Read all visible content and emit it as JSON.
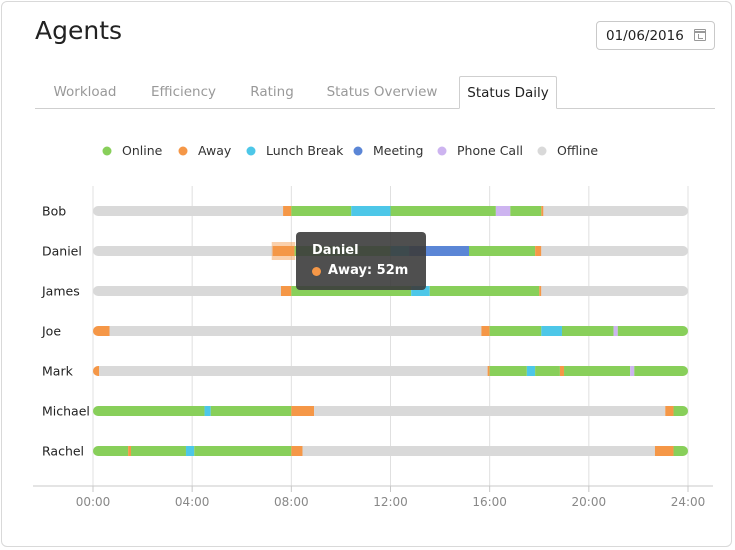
{
  "header": {
    "title": "Agents",
    "date": "01/06/2016"
  },
  "tabs": [
    {
      "label": "Workload"
    },
    {
      "label": "Efficiency"
    },
    {
      "label": "Rating"
    },
    {
      "label": "Status Overview"
    },
    {
      "label": "Status Daily"
    }
  ],
  "active_tab": "Status Daily",
  "tooltip": {
    "title": "Daniel",
    "status": "Away",
    "value": "52m",
    "text": "Away: 52m",
    "color": "#f59747"
  },
  "chart_data": {
    "type": "timeline",
    "title": "",
    "xlabel": "",
    "ylabel": "",
    "x_range": [
      "00:00",
      "24:00"
    ],
    "x_ticks": [
      "00:00",
      "04:00",
      "08:00",
      "12:00",
      "16:00",
      "20:00",
      "24:00"
    ],
    "legend_position": "top",
    "legend": [
      {
        "name": "Online",
        "color": "#88cf5a"
      },
      {
        "name": "Away",
        "color": "#f59747"
      },
      {
        "name": "Lunch Break",
        "color": "#4dc7e8"
      },
      {
        "name": "Meeting",
        "color": "#5b86d6"
      },
      {
        "name": "Phone Call",
        "color": "#cdb4f0"
      },
      {
        "name": "Offline",
        "color": "#d9d9d9"
      }
    ],
    "agents": [
      {
        "name": "Bob",
        "segments": [
          {
            "status": "Offline",
            "start": "00:00",
            "end": "07:40"
          },
          {
            "status": "Away",
            "start": "07:40",
            "end": "08:00"
          },
          {
            "status": "Online",
            "start": "08:00",
            "end": "10:25"
          },
          {
            "status": "Lunch Break",
            "start": "10:25",
            "end": "12:00"
          },
          {
            "status": "Online",
            "start": "12:00",
            "end": "16:15"
          },
          {
            "status": "Phone Call",
            "start": "16:15",
            "end": "16:50"
          },
          {
            "status": "Online",
            "start": "16:50",
            "end": "18:05"
          },
          {
            "status": "Away",
            "start": "18:05",
            "end": "18:10"
          },
          {
            "status": "Offline",
            "start": "18:10",
            "end": "24:00"
          }
        ]
      },
      {
        "name": "Daniel",
        "segments": [
          {
            "status": "Offline",
            "start": "00:00",
            "end": "07:15"
          },
          {
            "status": "Away",
            "start": "07:15",
            "end": "08:07"
          },
          {
            "status": "Online",
            "start": "08:07",
            "end": "12:00"
          },
          {
            "status": "Lunch Break",
            "start": "12:00",
            "end": "12:45"
          },
          {
            "status": "Meeting",
            "start": "12:45",
            "end": "15:10"
          },
          {
            "status": "Online",
            "start": "15:10",
            "end": "17:50"
          },
          {
            "status": "Away",
            "start": "17:50",
            "end": "18:05"
          },
          {
            "status": "Offline",
            "start": "18:05",
            "end": "24:00"
          }
        ]
      },
      {
        "name": "James",
        "segments": [
          {
            "status": "Offline",
            "start": "00:00",
            "end": "07:35"
          },
          {
            "status": "Away",
            "start": "07:35",
            "end": "08:00"
          },
          {
            "status": "Online",
            "start": "08:00",
            "end": "12:50"
          },
          {
            "status": "Lunch Break",
            "start": "12:50",
            "end": "13:35"
          },
          {
            "status": "Online",
            "start": "13:35",
            "end": "18:00"
          },
          {
            "status": "Away",
            "start": "18:00",
            "end": "18:05"
          },
          {
            "status": "Offline",
            "start": "18:05",
            "end": "24:00"
          }
        ]
      },
      {
        "name": "Joe",
        "segments": [
          {
            "status": "Away",
            "start": "00:00",
            "end": "00:40"
          },
          {
            "status": "Offline",
            "start": "00:40",
            "end": "15:40"
          },
          {
            "status": "Away",
            "start": "15:40",
            "end": "16:00"
          },
          {
            "status": "Online",
            "start": "16:00",
            "end": "18:05"
          },
          {
            "status": "Lunch Break",
            "start": "18:05",
            "end": "18:55"
          },
          {
            "status": "Online",
            "start": "18:55",
            "end": "21:00"
          },
          {
            "status": "Phone Call",
            "start": "21:00",
            "end": "21:10"
          },
          {
            "status": "Online",
            "start": "21:10",
            "end": "24:00"
          }
        ]
      },
      {
        "name": "Mark",
        "segments": [
          {
            "status": "Away",
            "start": "00:00",
            "end": "00:15"
          },
          {
            "status": "Offline",
            "start": "00:15",
            "end": "15:55"
          },
          {
            "status": "Away",
            "start": "15:55",
            "end": "16:00"
          },
          {
            "status": "Online",
            "start": "16:00",
            "end": "17:30"
          },
          {
            "status": "Lunch Break",
            "start": "17:30",
            "end": "17:50"
          },
          {
            "status": "Online",
            "start": "17:50",
            "end": "18:50"
          },
          {
            "status": "Away",
            "start": "18:50",
            "end": "19:00"
          },
          {
            "status": "Online",
            "start": "19:00",
            "end": "21:40"
          },
          {
            "status": "Phone Call",
            "start": "21:40",
            "end": "21:50"
          },
          {
            "status": "Online",
            "start": "21:50",
            "end": "24:00"
          }
        ]
      },
      {
        "name": "Michael",
        "segments": [
          {
            "status": "Online",
            "start": "00:00",
            "end": "04:30"
          },
          {
            "status": "Lunch Break",
            "start": "04:30",
            "end": "04:45"
          },
          {
            "status": "Online",
            "start": "04:45",
            "end": "08:00"
          },
          {
            "status": "Away",
            "start": "08:00",
            "end": "08:55"
          },
          {
            "status": "Offline",
            "start": "08:55",
            "end": "23:05"
          },
          {
            "status": "Away",
            "start": "23:05",
            "end": "23:25"
          },
          {
            "status": "Online",
            "start": "23:25",
            "end": "24:00"
          }
        ]
      },
      {
        "name": "Rachel",
        "segments": [
          {
            "status": "Online",
            "start": "00:00",
            "end": "01:25"
          },
          {
            "status": "Away",
            "start": "01:25",
            "end": "01:32"
          },
          {
            "status": "Online",
            "start": "01:32",
            "end": "03:45"
          },
          {
            "status": "Lunch Break",
            "start": "03:45",
            "end": "04:05"
          },
          {
            "status": "Online",
            "start": "04:05",
            "end": "08:00"
          },
          {
            "status": "Away",
            "start": "08:00",
            "end": "08:27"
          },
          {
            "status": "Offline",
            "start": "08:27",
            "end": "22:40"
          },
          {
            "status": "Away",
            "start": "22:40",
            "end": "23:25"
          },
          {
            "status": "Online",
            "start": "23:25",
            "end": "24:00"
          }
        ]
      }
    ]
  }
}
